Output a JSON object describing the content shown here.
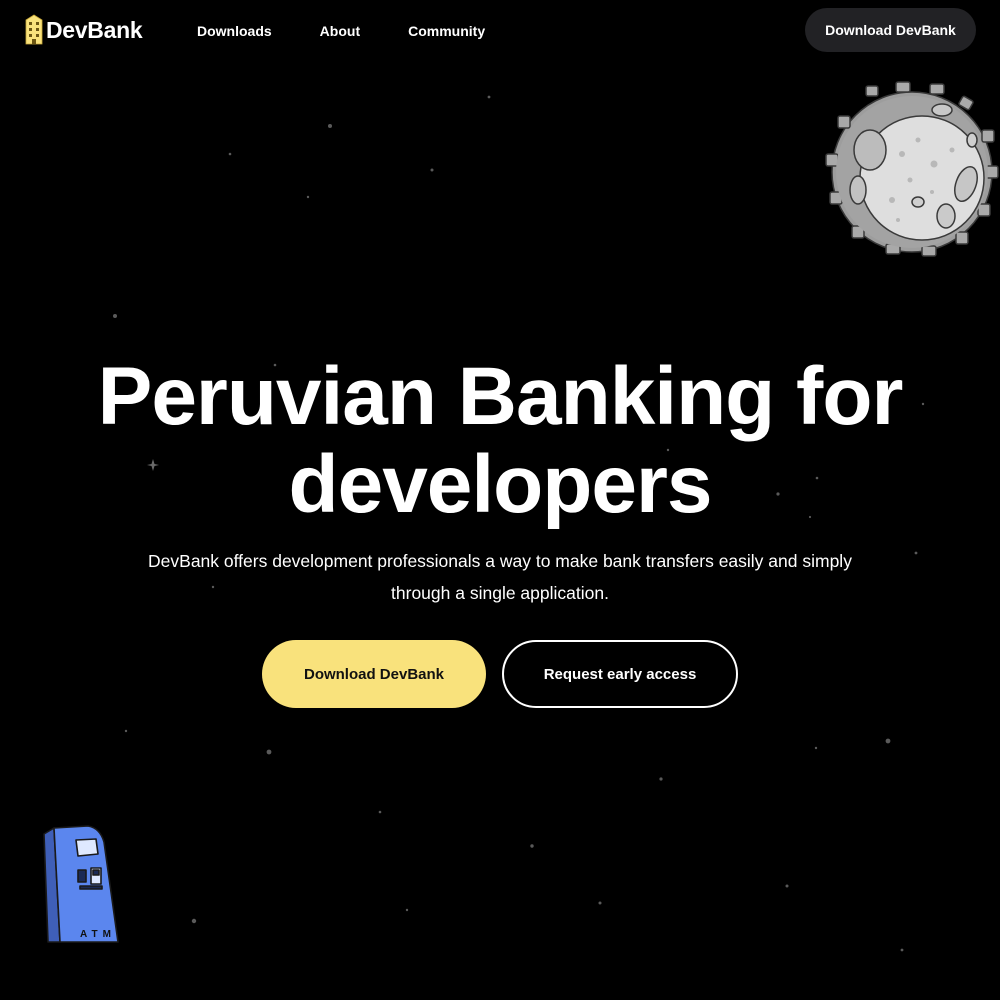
{
  "brand": {
    "name": "DevBank",
    "accent_color": "#f9e27c",
    "logo_icon": "building-icon"
  },
  "nav": {
    "items": [
      {
        "label": "Downloads"
      },
      {
        "label": "About"
      },
      {
        "label": "Community"
      }
    ],
    "cta_label": "Download DevBank"
  },
  "hero": {
    "title_line1": "Peruvian Banking for",
    "title_line2": "developers",
    "subtitle": "DevBank offers development professionals a way to make bank transfers easily and simply through a single application.",
    "primary_button": "Download DevBank",
    "secondary_button": "Request early access"
  },
  "illustrations": {
    "moon": "moon-illustration",
    "atm": "atm-illustration",
    "atm_label": "ATM"
  },
  "colors": {
    "background": "#000000",
    "header_button_bg": "#222225",
    "atm_blue": "#5b86ee"
  }
}
